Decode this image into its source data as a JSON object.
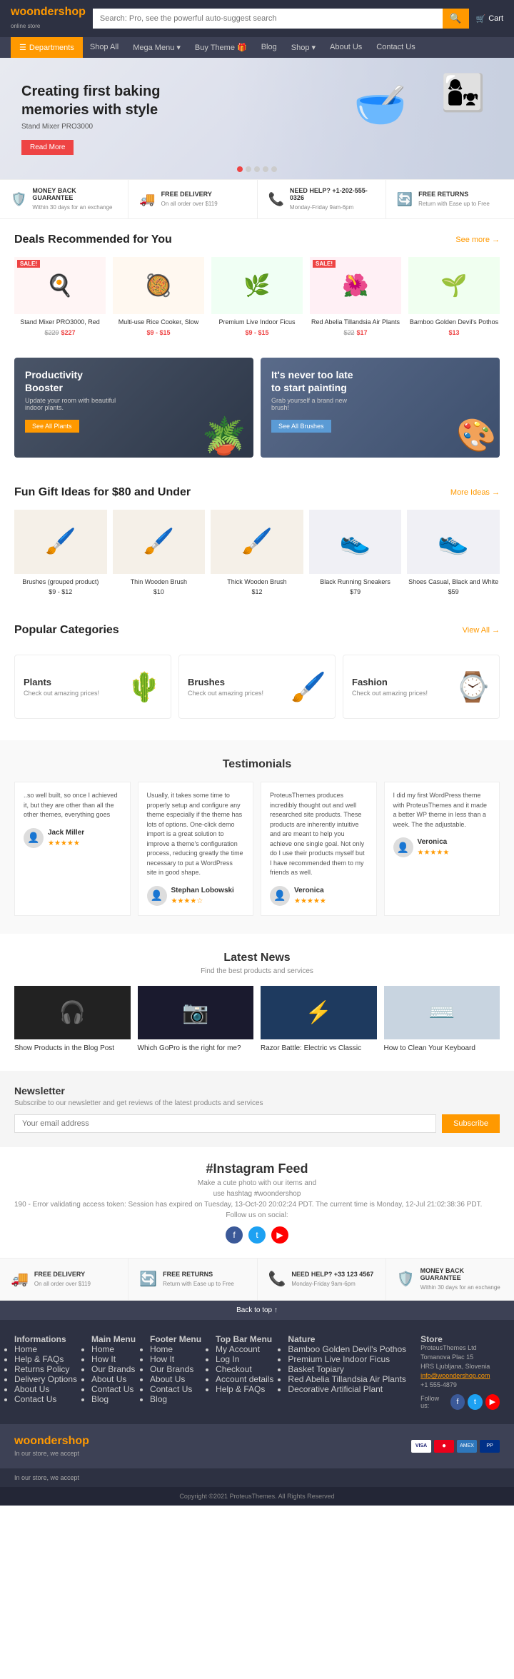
{
  "header": {
    "logo_main": "woonder",
    "logo_sub": "shop",
    "logo_tagline": "online store",
    "search_placeholder": "Search: Pro, see the powerful auto-suggest search",
    "cart_label": "Cart"
  },
  "nav": {
    "dept_label": "Departments",
    "links": [
      {
        "label": "Shop All"
      },
      {
        "label": "Mega Menu ▾"
      },
      {
        "label": "Buy Theme 🎁"
      },
      {
        "label": "Blog"
      },
      {
        "label": "Shop ▾"
      },
      {
        "label": "About Us"
      },
      {
        "label": "Contact Us"
      }
    ]
  },
  "hero": {
    "headline": "Creating first baking memories with style",
    "subtext": "Stand Mixer PRO3000",
    "btn_label": "Read More",
    "dots": [
      1,
      2,
      3,
      4,
      5
    ]
  },
  "features": [
    {
      "icon": "🛡️",
      "title": "MONEY BACK GUARANTEE",
      "desc": "Within 30 days for an exchange"
    },
    {
      "icon": "🚚",
      "title": "FREE DELIVERY",
      "desc": "On all order over $119"
    },
    {
      "icon": "📞",
      "title": "NEED HELP? +1-202-555-0326",
      "desc": "Monday-Friday 9am-6pm"
    },
    {
      "icon": "🔄",
      "title": "FREE RETURNS",
      "desc": "Return with Ease up to Free"
    }
  ],
  "deals": {
    "title": "Deals Recommended for You",
    "see_more": "See more →",
    "products": [
      {
        "name": "Stand Mixer PRO3000, Red",
        "price_original": "$229",
        "price_current": "$227",
        "icon": "🍳",
        "sale": true
      },
      {
        "name": "Multi-use Rice Cooker, Slow",
        "price_original": "",
        "price_current": "$9 - $15",
        "icon": "🥘",
        "sale": false
      },
      {
        "name": "Premium Live Indoor Ficus",
        "price_original": "",
        "price_current": "$9 - $15",
        "icon": "🌿",
        "sale": false
      },
      {
        "name": "Red Abelia Tillandsia Air Plants",
        "price_original": "$22",
        "price_current": "$17",
        "icon": "🌺",
        "sale": true
      },
      {
        "name": "Bamboo Golden Devil's Pothos",
        "price_original": "",
        "price_current": "$13",
        "icon": "🌱",
        "sale": false
      }
    ]
  },
  "promo_banners": [
    {
      "title": "Productivity Booster",
      "desc": "Update your room with beautiful indoor plants.",
      "btn_label": "See All Plants",
      "btn_style": "yellow",
      "icon": "🌿"
    },
    {
      "title": "It's never too late to start painting",
      "desc": "Grab yourself a brand new brush!",
      "btn_label": "See All Brushes",
      "btn_style": "blue",
      "icon": "🎨"
    }
  ],
  "gifts": {
    "title": "Fun Gift Ideas for $80 and Under",
    "more_label": "More Ideas →",
    "products": [
      {
        "name": "Brushes (grouped product)",
        "price": "$9 - $12",
        "icon": "🖌️"
      },
      {
        "name": "Thin Wooden Brush",
        "price": "$10",
        "icon": "🖌️"
      },
      {
        "name": "Thick Wooden Brush",
        "price": "$12",
        "icon": "🖌️"
      },
      {
        "name": "Black Running Sneakers",
        "price": "$79",
        "icon": "👟"
      },
      {
        "name": "Shoes Casual, Black and White",
        "price": "$59",
        "icon": "👟"
      }
    ]
  },
  "categories": {
    "title": "Popular Categories",
    "view_all": "View All →",
    "items": [
      {
        "name": "Plants",
        "desc": "Check out amazing prices!",
        "icon": "🌵"
      },
      {
        "name": "Brushes",
        "desc": "Check out amazing prices!",
        "icon": "🖌️"
      },
      {
        "name": "Fashion",
        "desc": "Check out amazing prices!",
        "icon": "⌚"
      }
    ]
  },
  "testimonials": {
    "title": "Testimonials",
    "items": [
      {
        "text": "..so well built, so once I achieved it, but they are other than all the other themes, everything goes",
        "author": "Jack Miller",
        "stars": 5
      },
      {
        "text": "Usually, it takes some time to properly setup and configure any theme especially if the theme has lots of options. One-click demo import is a great solution to improve a theme's configuration process, reducing greatly the time necessary to put a WordPress site in good shape.",
        "author": "Stephan Lobowski",
        "stars": 4
      },
      {
        "text": "ProteusThemes produces incredibly thought out and well researched site products. These products are inherently intuitive and are meant to help you achieve one single goal. Not only do I use their products myself but I have recommended them to my friends as well.",
        "author": "Veronica",
        "stars": 5
      },
      {
        "text": "I did my first WordPress theme with ProteusThemes and it made a better WP theme in less than a week. The the adjustable.",
        "author": "Veronica",
        "stars": 5
      }
    ]
  },
  "news": {
    "title": "Latest News",
    "subtitle": "Find the best products and services",
    "items": [
      {
        "title": "Show Products in the Blog Post",
        "img_color": "#222"
      },
      {
        "title": "Which GoPro is the right for me?",
        "img_color": "#1a1a2e"
      },
      {
        "title": "Razor Battle: Electric vs Classic",
        "img_color": "#1e3a5f"
      },
      {
        "title": "How to Clean Your Keyboard",
        "img_color": "#c8d4e0"
      }
    ]
  },
  "newsletter": {
    "title": "Newsletter",
    "desc": "Subscribe to our newsletter and get reviews of the latest products and services",
    "placeholder": "Your email address",
    "btn_label": "Subscribe"
  },
  "instagram": {
    "title": "#Instagram Feed",
    "subtitle": "Make a cute photo with our items and",
    "hashtag": "use hashtag #woondershop",
    "follow_label": "Follow us on social:",
    "error": "190 - Error validating access token: Session has expired on Tuesday, 13-Oct-20 20:02:24 PDT. The current time is Monday, 12-Jul 21:02:38:36 PDT.",
    "social": [
      "f",
      "t",
      "▶"
    ]
  },
  "footer_features": [
    {
      "icon": "🚚",
      "title": "FREE DELIVERY",
      "desc": "On all order over $119"
    },
    {
      "icon": "🔄",
      "title": "FREE RETURNS",
      "desc": "Return with Ease up to Free"
    },
    {
      "icon": "📞",
      "title": "NEED HELP? +33 123 4567",
      "desc": "Monday-Friday 9am-6pm"
    },
    {
      "icon": "🛡️",
      "title": "MONEY BACK GUARANTEE",
      "desc": "Within 30 days for an exchange"
    }
  ],
  "back_top": "Back to top ↑",
  "footer": {
    "cols": [
      {
        "title": "Informations",
        "items": [
          "Home",
          "Help & FAQs",
          "Returns Policy",
          "Delivery Options",
          "About Us",
          "Contact Us"
        ]
      },
      {
        "title": "Main Menu",
        "items": [
          "Home",
          "How It",
          "Our Brands",
          "About Us",
          "Contact Us",
          "Blog"
        ]
      },
      {
        "title": "Footer Menu",
        "items": [
          "Home",
          "How It",
          "Our Brands",
          "About Us",
          "Contact Us",
          "Blog"
        ]
      },
      {
        "title": "Top Bar Menu",
        "items": [
          "My Account",
          "Log In",
          "Checkout",
          "Account details",
          "Help & FAQs"
        ]
      },
      {
        "title": "Nature",
        "items": [
          "Bamboo Golden Devil's Pothos",
          "Premium Live Indoor Ficus",
          "Basket Topiary",
          "Red Abelia Tillandsia Air Plants",
          "Decorative Artificial Plant"
        ]
      }
    ],
    "store": {
      "title": "Store",
      "address": "ProteusThemes Ltd\nTomanova Plac 15\nHRS Ljubljana, Slovenia",
      "email": "info@woondershop.com",
      "phone": "+1 555-4879"
    },
    "follow_label": "Follow us:",
    "follow_icons": [
      "f",
      "t",
      "▶"
    ]
  },
  "footer_bottom": {
    "logo_main": "woonder",
    "logo_sub": "shop",
    "tagline": "In our store, we accept",
    "copyright": "Copyright ©2021 ProteusThemes. All Rights Reserved"
  }
}
